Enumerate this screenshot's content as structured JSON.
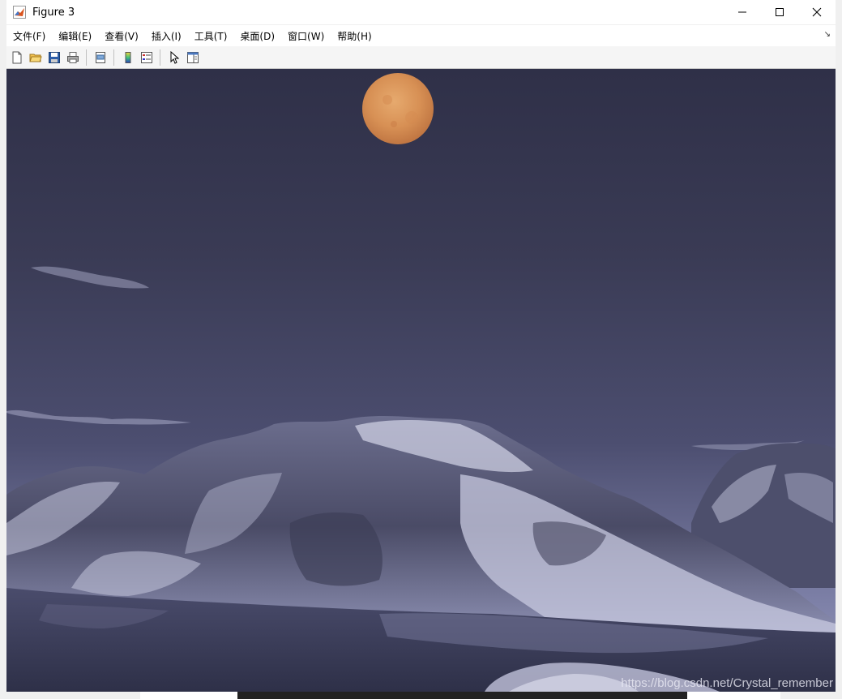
{
  "window": {
    "title": "Figure 3"
  },
  "menu": {
    "items": [
      "文件(F)",
      "编辑(E)",
      "查看(V)",
      "插入(I)",
      "工具(T)",
      "桌面(D)",
      "窗口(W)",
      "帮助(H)"
    ]
  },
  "toolbar": {
    "buttons": [
      "new-figure-icon",
      "open-file-icon",
      "save-icon",
      "print-icon",
      "print-preview-icon",
      "colorbar-icon",
      "legend-icon",
      "edit-plot-icon",
      "property-editor-icon"
    ]
  },
  "figure": {
    "scene": "night sky with full moon over snowy mountains and lake",
    "watermark": "https://blog.csdn.net/Crystal_remember"
  },
  "colors": {
    "sky_top": "#2f3048",
    "sky_bottom": "#9a9cc0",
    "moon": "#e8a060",
    "mountain_dark": "#3a3a52",
    "snow": "#c8cadf",
    "water": "#454766"
  }
}
